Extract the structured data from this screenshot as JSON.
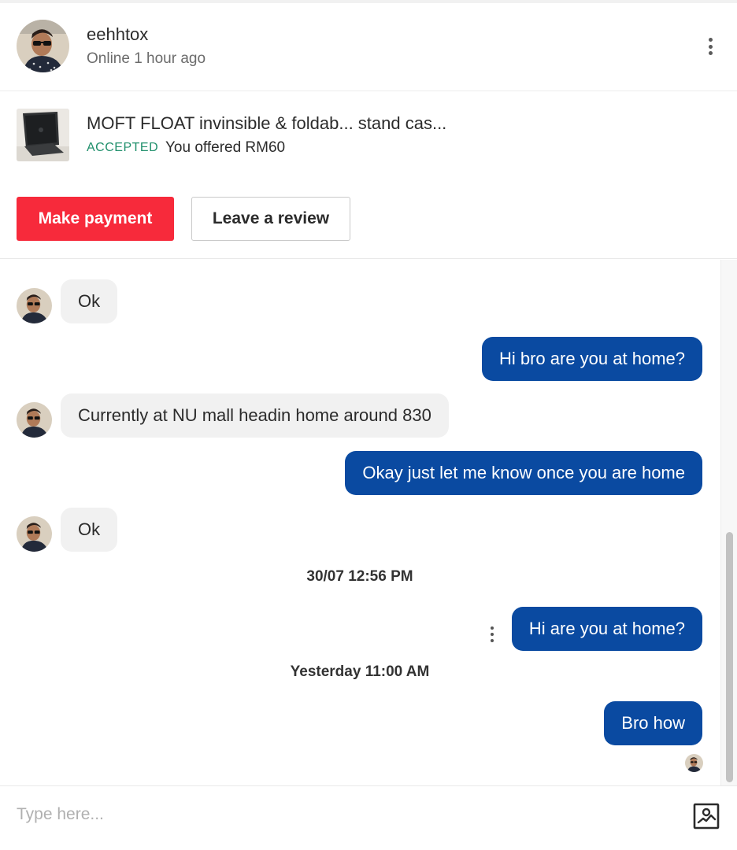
{
  "header": {
    "username": "eehhtox",
    "status": "Online 1 hour ago"
  },
  "listing": {
    "title": "MOFT FLOAT invinsible & foldab... stand cas...",
    "status_badge": "ACCEPTED",
    "offer_text": "You offered RM60",
    "pay_label": "Make payment",
    "review_label": "Leave a review"
  },
  "messages": [
    {
      "dir": "in",
      "text": "Ok"
    },
    {
      "dir": "out",
      "text": "Hi bro are you at home?"
    },
    {
      "dir": "in",
      "text": "Currently at NU mall headin home around 830"
    },
    {
      "dir": "out",
      "text": "Okay just let me know once you are home"
    },
    {
      "dir": "in",
      "text": "Ok"
    },
    {
      "dir": "time",
      "text": "30/07  12:56 PM"
    },
    {
      "dir": "out",
      "text": "Hi are you at home?"
    },
    {
      "dir": "time",
      "text": "Yesterday  11:00 AM"
    },
    {
      "dir": "out",
      "text": "Bro how"
    }
  ],
  "composer": {
    "placeholder": "Type here..."
  },
  "colors": {
    "primary_red": "#f72a3b",
    "outgoing_bubble": "#0a4aa1",
    "incoming_bubble": "#f1f1f1",
    "accepted_green": "#1f8f6b"
  },
  "icons": {
    "more": "more-vertical-icon",
    "image_upload": "image-upload-icon"
  }
}
